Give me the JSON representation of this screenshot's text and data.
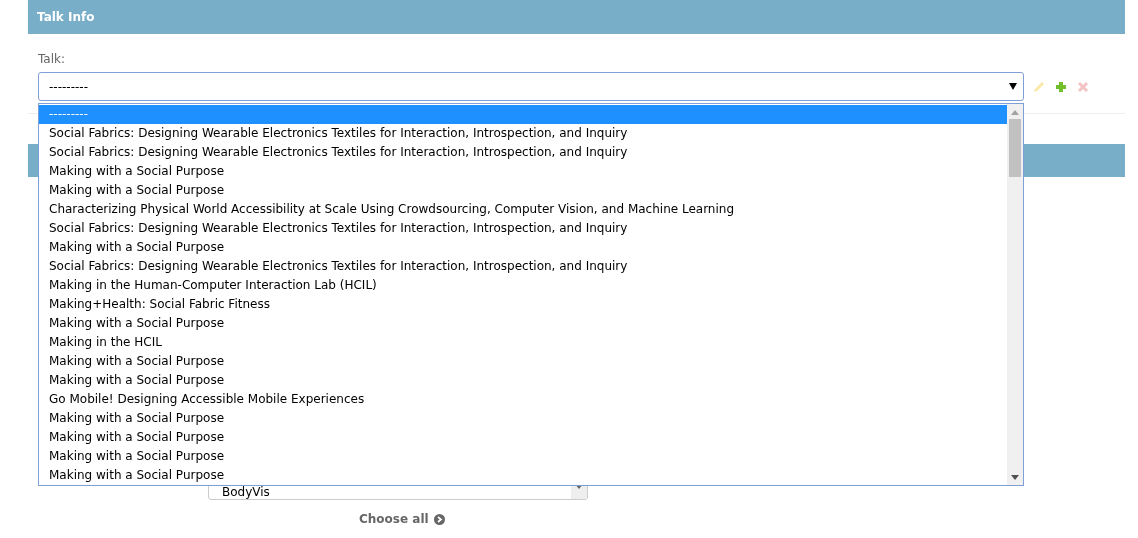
{
  "section": {
    "title": "Talk Info"
  },
  "talk_field": {
    "label": "Talk:",
    "value": "---------",
    "actions": [
      {
        "kind": "edit",
        "disabled": true
      },
      {
        "kind": "add",
        "disabled": false
      },
      {
        "kind": "delete",
        "disabled": true
      }
    ]
  },
  "dropdown": {
    "options": [
      {
        "label": "---------",
        "selected": true
      },
      {
        "label": "Social Fabrics: Designing Wearable Electronics Textiles for Interaction, Introspection, and Inquiry",
        "selected": false
      },
      {
        "label": "Social Fabrics: Designing Wearable Electronics Textiles for Interaction, Introspection, and Inquiry",
        "selected": false
      },
      {
        "label": "Making with a Social Purpose",
        "selected": false
      },
      {
        "label": "Making with a Social Purpose",
        "selected": false
      },
      {
        "label": "Characterizing Physical World Accessibility at Scale Using Crowdsourcing, Computer Vision, and Machine Learning",
        "selected": false
      },
      {
        "label": "Social Fabrics: Designing Wearable Electronics Textiles for Interaction, Introspection, and Inquiry",
        "selected": false
      },
      {
        "label": "Making with a Social Purpose",
        "selected": false
      },
      {
        "label": "Social Fabrics: Designing Wearable Electronics Textiles for Interaction, Introspection, and Inquiry",
        "selected": false
      },
      {
        "label": "Making in the Human-Computer Interaction Lab (HCIL)",
        "selected": false
      },
      {
        "label": "Making+Health: Social Fabric Fitness",
        "selected": false
      },
      {
        "label": "Making with a Social Purpose",
        "selected": false
      },
      {
        "label": "Making in the HCIL",
        "selected": false
      },
      {
        "label": "Making with a Social Purpose",
        "selected": false
      },
      {
        "label": "Making with a Social Purpose",
        "selected": false
      },
      {
        "label": "Go Mobile! Designing Accessible Mobile Experiences",
        "selected": false
      },
      {
        "label": "Making with a Social Purpose",
        "selected": false
      },
      {
        "label": "Making with a Social Purpose",
        "selected": false
      },
      {
        "label": "Making with a Social Purpose",
        "selected": false
      },
      {
        "label": "Making with a Social Purpose",
        "selected": false
      }
    ]
  },
  "lower_select": {
    "value": "BodyVis"
  },
  "choose_all": {
    "label": "Choose all"
  }
}
